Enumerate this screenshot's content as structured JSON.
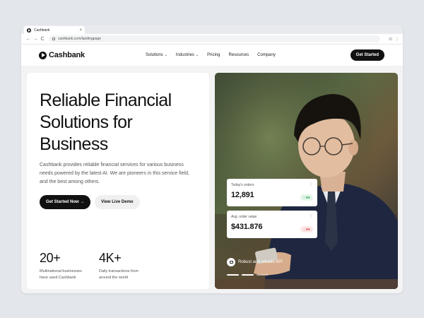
{
  "browser": {
    "tab_title": "Cashbank",
    "tab_close": "×",
    "url": "cashbank.com/landingpage",
    "back_icon": "←",
    "forward_icon": "→",
    "reload_icon": "C",
    "extensions_icon": "⊙",
    "menu_icon": "⋮"
  },
  "nav": {
    "brand": "Cashbank",
    "items": [
      {
        "label": "Solutions",
        "has_dropdown": true
      },
      {
        "label": "Industries",
        "has_dropdown": true
      },
      {
        "label": "Pricing",
        "has_dropdown": false
      },
      {
        "label": "Resources",
        "has_dropdown": false
      },
      {
        "label": "Company",
        "has_dropdown": false
      }
    ],
    "dropdown_icon": "⌄",
    "cta": "Get Started"
  },
  "hero": {
    "title_lines": [
      "Reliable Financial",
      "Solutions for",
      "Business"
    ],
    "description": "Cashbank provides reliable financial services for various business needs powered by the latest AI. We are pioneers in this service field, and the best among others.",
    "primary_button": "Get Started Now  →",
    "secondary_button": "View Live Demo",
    "stats": [
      {
        "value": "20+",
        "label": "Multinational businesses have used Cashbank"
      },
      {
        "value": "4K+",
        "label": "Daily transactions from around the world"
      }
    ]
  },
  "image_panel": {
    "cards": [
      {
        "label": "Today's orders",
        "value": "12,891",
        "badge": "↑ 3%",
        "trend": "up"
      },
      {
        "label": "Avg. order value",
        "value": "$431.876",
        "badge": "↓ 3%",
        "trend": "down"
      }
    ],
    "card_menu_icon": "⋮",
    "caption": "Robust and reliable API",
    "carousel_dots": 3,
    "active_dot": 2
  },
  "colors": {
    "brand_dark": "#111111",
    "trend_up": "#1f9a4b",
    "trend_down": "#d33b3b",
    "page_bg": "#e3e6ea"
  }
}
